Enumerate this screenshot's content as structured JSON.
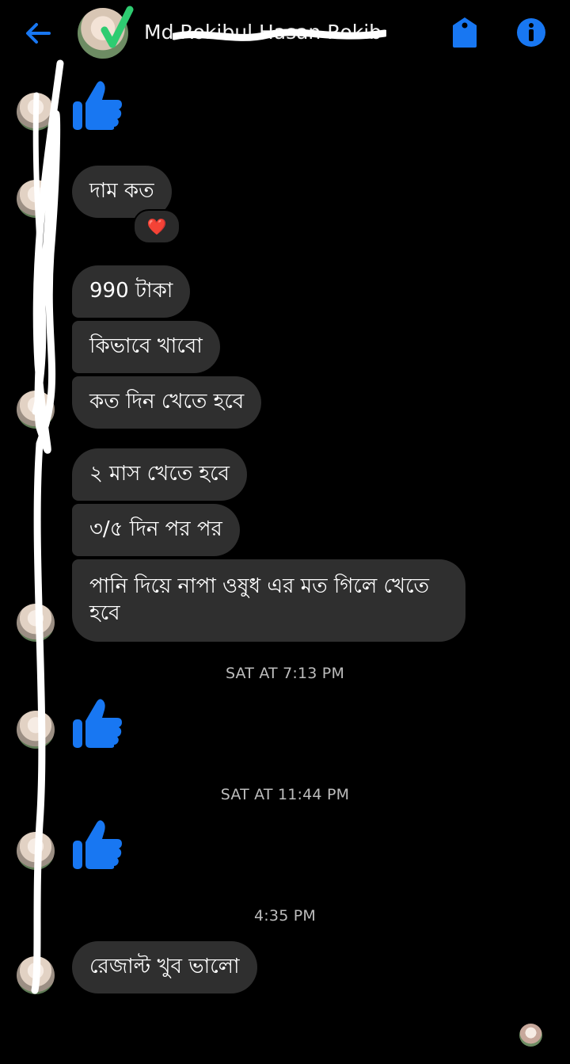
{
  "header": {
    "title": "Md Rokibul Hasan Rokib",
    "back_icon": "arrow-left-icon",
    "tag_icon": "tag-icon",
    "info_icon": "info-icon",
    "accent_color": "#1877f2"
  },
  "messages": {
    "m1": "দাম কত",
    "m1_reaction": "❤️",
    "m2": "990 টাকা",
    "m3": "কিভাবে খাবো",
    "m4": "কত দিন খেতে হবে",
    "m5": "২ মাস খেতে হবে",
    "m6": "৩/৫ দিন পর পর",
    "m7": "পানি দিয়ে নাপা ওষুধ এর মত গিলে খেতে হবে",
    "m8": "রেজাল্ট খুব ভালো"
  },
  "timestamps": {
    "t1": "SAT AT 7:13 PM",
    "t2": "SAT AT 11:44 PM",
    "t3": "4:35 PM"
  }
}
